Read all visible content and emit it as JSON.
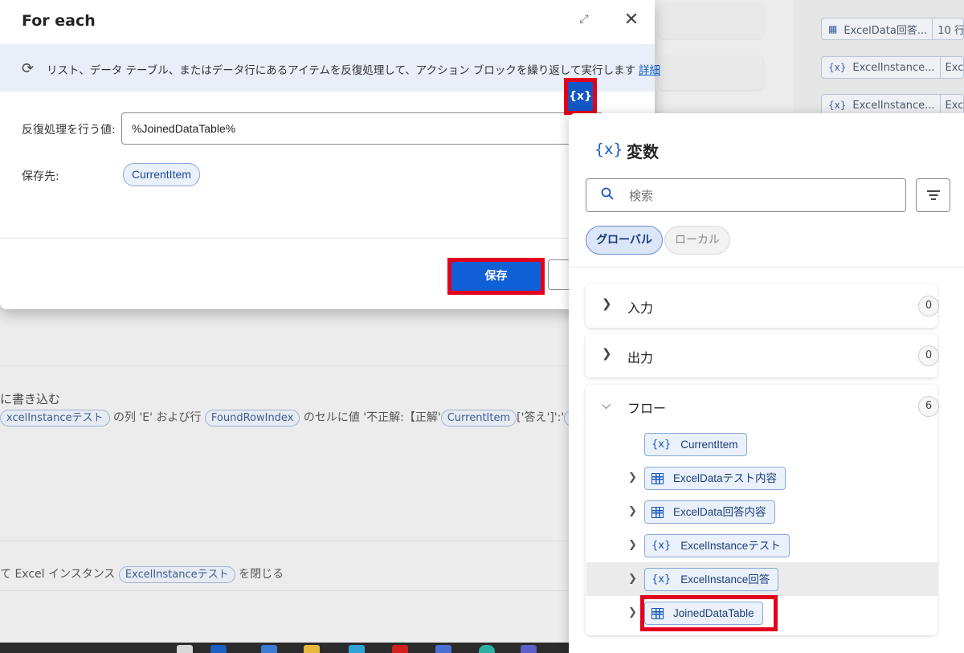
{
  "background": {
    "right_cards": [
      {
        "label": "ExcelData回答...",
        "value": "10 行",
        "icon": "grid-icon"
      },
      {
        "label": "ExcelInstance...",
        "value": "Excel",
        "icon": "var-icon"
      },
      {
        "label": "ExcelInstance...",
        "value": "Excel",
        "icon": "var-icon"
      }
    ],
    "write_action": {
      "title": "に書き込む",
      "parts": [
        "xcelInstanceテスト",
        " の列 'E' および行 ",
        "FoundRowIndex",
        " のセルに値 '不正解:【正解'",
        "CurrentItem",
        "['答え']':'",
        "C"
      ]
    },
    "close_action": {
      "parts": [
        "て Excel インスタンス ",
        "ExcelInstanceテスト",
        " を閉じる"
      ]
    }
  },
  "dialog": {
    "title": "For each",
    "info_text": "リスト、データ テーブル、またはデータ行にあるアイテムを反復処理して、アクション ブロックを繰り返して実行します",
    "info_link": "詳細",
    "var_button_label": "{x}",
    "iterate_label": "反復処理を行う値:",
    "iterate_value": "%JoinedDataTable%",
    "store_label": "保存先:",
    "store_value": "CurrentItem",
    "save_label": "保存"
  },
  "variables_pane": {
    "title_icon": "{x}",
    "title": "変数",
    "search_placeholder": "検索",
    "tabs": {
      "global": "グローバル",
      "local": "ローカル"
    },
    "sections": [
      {
        "label": "入力",
        "count": "0",
        "expanded": false
      },
      {
        "label": "出力",
        "count": "0",
        "expanded": false
      },
      {
        "label": "フロー",
        "count": "6",
        "expanded": true
      }
    ],
    "flow_variables": [
      {
        "name": "CurrentItem",
        "icon": "var-icon",
        "expandable": false
      },
      {
        "name": "ExcelDataテスト内容",
        "icon": "grid-icon",
        "expandable": true
      },
      {
        "name": "ExcelData回答内容",
        "icon": "grid-icon",
        "expandable": true
      },
      {
        "name": "ExcelInstanceテスト",
        "icon": "var-icon",
        "expandable": true
      },
      {
        "name": "ExcelInstance回答",
        "icon": "var-icon",
        "expandable": true
      },
      {
        "name": "JoinedDataTable",
        "icon": "grid-icon",
        "expandable": true
      }
    ]
  },
  "colors": {
    "highlight_red": "#e4001b",
    "primary_blue": "#0f5fd6",
    "chip_bg": "#eaf1fb",
    "chip_border": "#89a9d8"
  }
}
